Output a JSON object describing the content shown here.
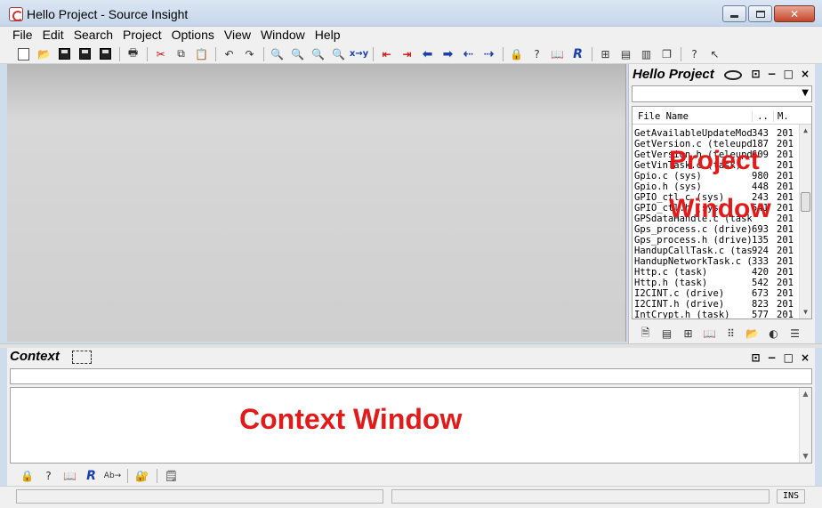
{
  "window": {
    "title": "Hello Project - Source Insight",
    "close_glyph": "✕"
  },
  "menu": {
    "items": [
      "File",
      "Edit",
      "Search",
      "Project",
      "Options",
      "View",
      "Window",
      "Help"
    ]
  },
  "project_panel": {
    "title": "Hello Project",
    "columns": [
      "File Name",
      "..",
      "M."
    ],
    "files": [
      {
        "name": "GetAvailableUpdateModu",
        "size": "343",
        "m": "201"
      },
      {
        "name": "GetVersion.c (teleupda",
        "size": "187",
        "m": "201"
      },
      {
        "name": "GetVersion.h (teleupda",
        "size": "609",
        "m": "201"
      },
      {
        "name": "GetVinTask.c (task)",
        "size": "",
        "m": "201"
      },
      {
        "name": "Gpio.c (sys)",
        "size": "980",
        "m": "201"
      },
      {
        "name": "Gpio.h (sys)",
        "size": "448",
        "m": "201"
      },
      {
        "name": "GPIO_ctl.c (sys)",
        "size": "243",
        "m": "201"
      },
      {
        "name": "GPIO_ctl.h (sys)",
        "size": "541",
        "m": "201"
      },
      {
        "name": "GPSdataHandle.c (task",
        "size": "",
        "m": "201"
      },
      {
        "name": "Gps_process.c (drive)",
        "size": "693",
        "m": "201"
      },
      {
        "name": "Gps_process.h (drive)",
        "size": "135",
        "m": "201"
      },
      {
        "name": "HandupCallTask.c (task",
        "size": "924",
        "m": "201"
      },
      {
        "name": "HandupNetworkTask.c (t",
        "size": "333",
        "m": "201"
      },
      {
        "name": "Http.c (task)",
        "size": "420",
        "m": "201"
      },
      {
        "name": "Http.h (task)",
        "size": "542",
        "m": "201"
      },
      {
        "name": "I2CINT.c (drive)",
        "size": "673",
        "m": "201"
      },
      {
        "name": "I2CINT.h (drive)",
        "size": "823",
        "m": "201"
      },
      {
        "name": "IntCrypt.h (task)",
        "size": "577",
        "m": "201"
      }
    ],
    "overlay_line1": "Project",
    "overlay_line2": "Window",
    "overlay_color": "#e21a1a"
  },
  "context_panel": {
    "title": "Context",
    "overlay": "Context Window"
  },
  "statusbar": {
    "mode": "INS"
  }
}
